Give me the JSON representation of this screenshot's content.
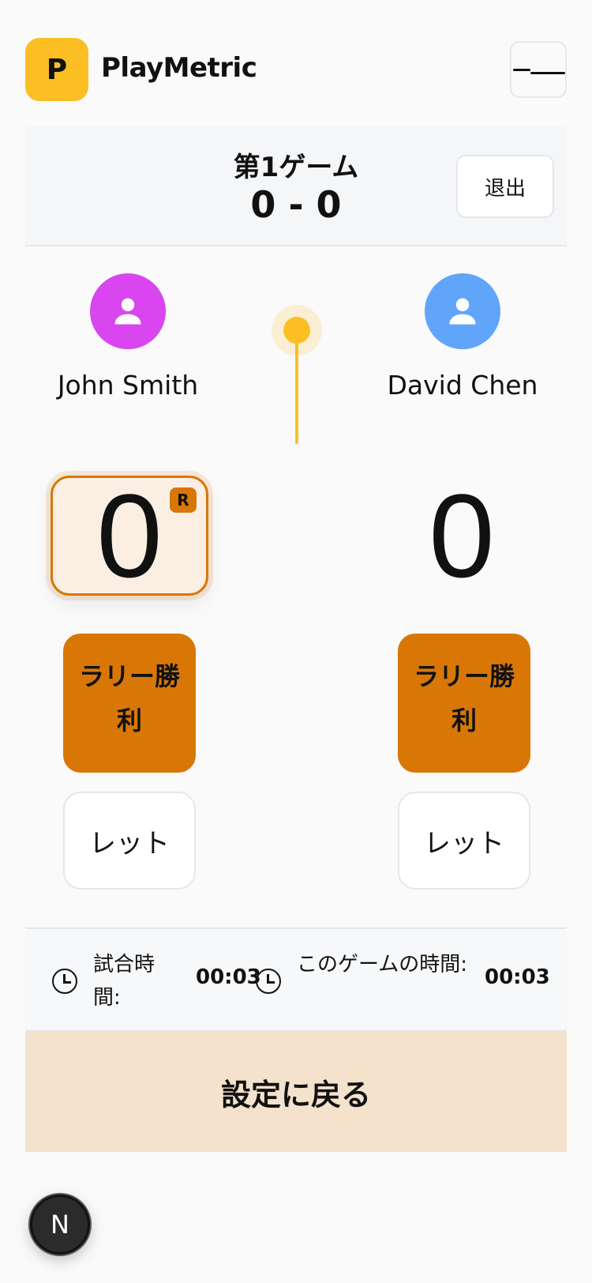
{
  "header": {
    "logo_letter": "P",
    "brand": "PlayMetric"
  },
  "game": {
    "title": "第1ゲーム",
    "score": "0 - 0",
    "exit_label": "退出"
  },
  "players": [
    {
      "name": "John Smith",
      "score": "0",
      "avatar_color": "#d946ef",
      "receiver_badge": "R"
    },
    {
      "name": "David Chen",
      "score": "0",
      "avatar_color": "#60a5fa"
    }
  ],
  "actions": {
    "rally_win_label": "ラリー勝利",
    "let_label": "レット"
  },
  "timers": {
    "match_label": "試合時間:",
    "match_value": "00:03",
    "game_label": "このゲームの時間:",
    "game_value": "00:03"
  },
  "footer": {
    "back_label": "設定に戻る",
    "fab_letter": "N"
  },
  "colors": {
    "accent": "#d97706",
    "serve": "#fbbf24",
    "logo": "#fbbf24"
  }
}
